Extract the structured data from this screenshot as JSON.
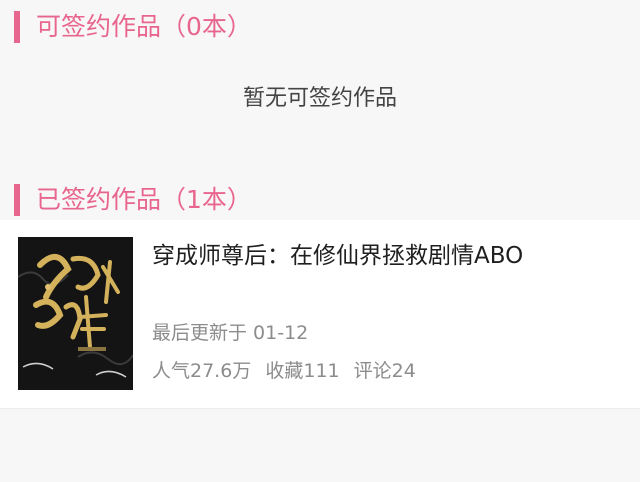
{
  "unsigned_section": {
    "title": "可签约作品（0本）",
    "empty_message": "暂无可签约作品"
  },
  "signed_section": {
    "title": "已签约作品（1本）",
    "books": [
      {
        "title": "穿成师尊后：在修仙界拯救剧情ABO",
        "updated": "最后更新于 01-12",
        "popularity": "人气27.6万",
        "favorites": "收藏111",
        "comments": "评论24",
        "cover_title": "修仙拯救剧情"
      }
    ]
  },
  "colors": {
    "accent": "#e8668e",
    "cover_bg": "#141414",
    "cover_gold": "#d4b25c"
  }
}
